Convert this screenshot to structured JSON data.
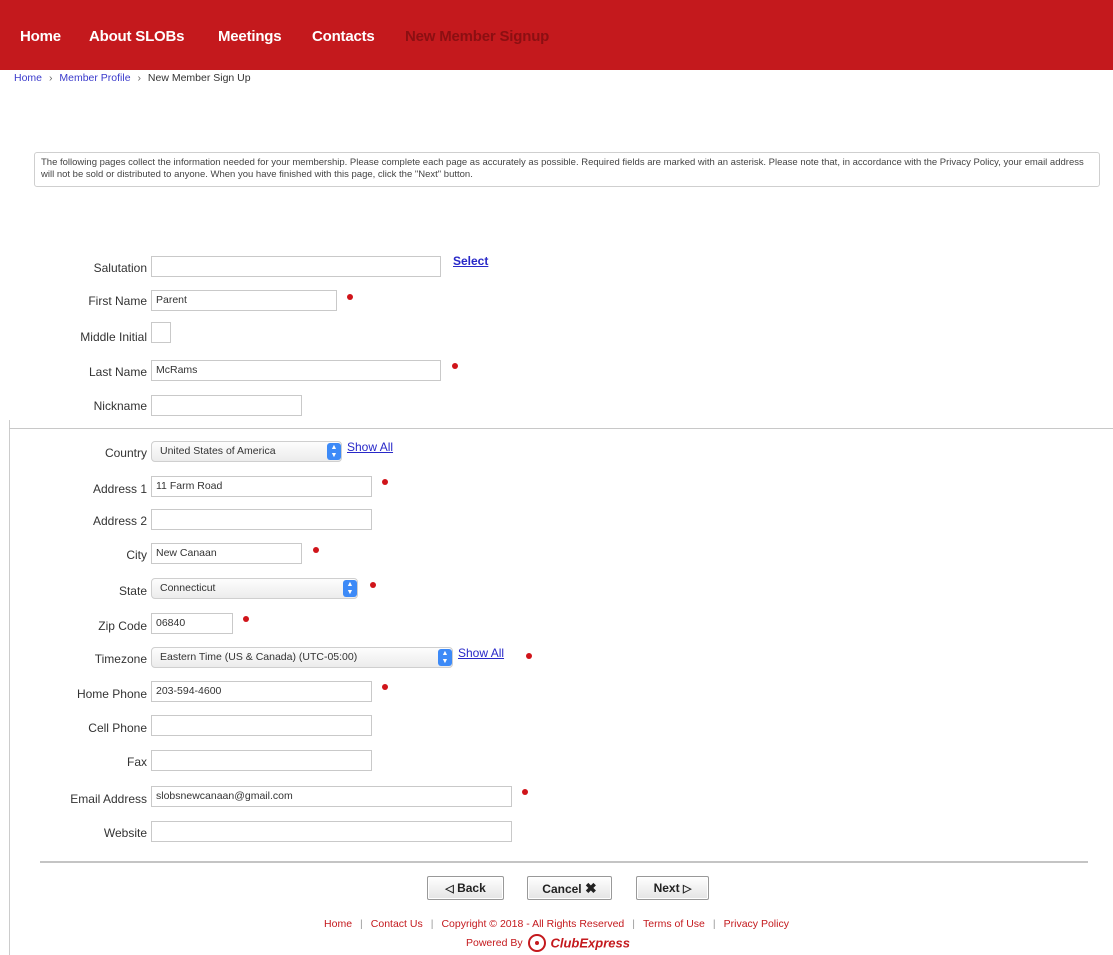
{
  "nav": {
    "items": [
      "Home",
      "About SLOBs",
      "Meetings",
      "Contacts",
      "New Member Signup"
    ]
  },
  "breadcrumb": {
    "home": "Home",
    "member_profile": "Member Profile",
    "current": "New Member Sign Up",
    "separator": "›"
  },
  "notice": "The following pages collect the information needed for your membership. Please complete each page as accurately as possible. Required fields are marked with an asterisk. Please note that, in accordance with the Privacy Policy, your email address will not be sold or distributed to anyone. When you have finished with this page, click the \"Next\" button.",
  "form": {
    "salutation": {
      "label": "Salutation",
      "value": "",
      "select_link": "Select"
    },
    "first_name": {
      "label": "First Name",
      "value": "Parent"
    },
    "middle_initial": {
      "label": "Middle Initial",
      "value": ""
    },
    "last_name": {
      "label": "Last Name",
      "value": "McRams"
    },
    "nickname": {
      "label": "Nickname",
      "value": ""
    },
    "country": {
      "label": "Country",
      "value": "United States of America",
      "show_all": "Show All"
    },
    "address1": {
      "label": "Address 1",
      "value": "11 Farm Road"
    },
    "address2": {
      "label": "Address 2",
      "value": ""
    },
    "city": {
      "label": "City",
      "value": "New Canaan"
    },
    "state": {
      "label": "State",
      "value": "Connecticut"
    },
    "zip": {
      "label": "Zip Code",
      "value": "06840"
    },
    "timezone": {
      "label": "Timezone",
      "value": "Eastern Time (US & Canada) (UTC-05:00)",
      "show_all": "Show All"
    },
    "home_phone": {
      "label": "Home Phone",
      "value": "203-594-4600"
    },
    "cell_phone": {
      "label": "Cell Phone",
      "value": ""
    },
    "fax": {
      "label": "Fax",
      "value": ""
    },
    "email": {
      "label": "Email Address",
      "value": "slobsnewcanaan@gmail.com"
    },
    "website": {
      "label": "Website",
      "value": ""
    }
  },
  "buttons": {
    "back": "Back",
    "cancel": "Cancel",
    "next": "Next"
  },
  "footer": {
    "home": "Home",
    "contact": "Contact Us",
    "copyright": "Copyright © 2018 - All Rights Reserved",
    "terms": "Terms of Use",
    "privacy": "Privacy Policy",
    "powered_by": "Powered By",
    "brand": "ClubExpress"
  },
  "colors": {
    "nav_bg": "#c4191d",
    "required_dot": "#d0141a",
    "link": "#2828c8"
  }
}
